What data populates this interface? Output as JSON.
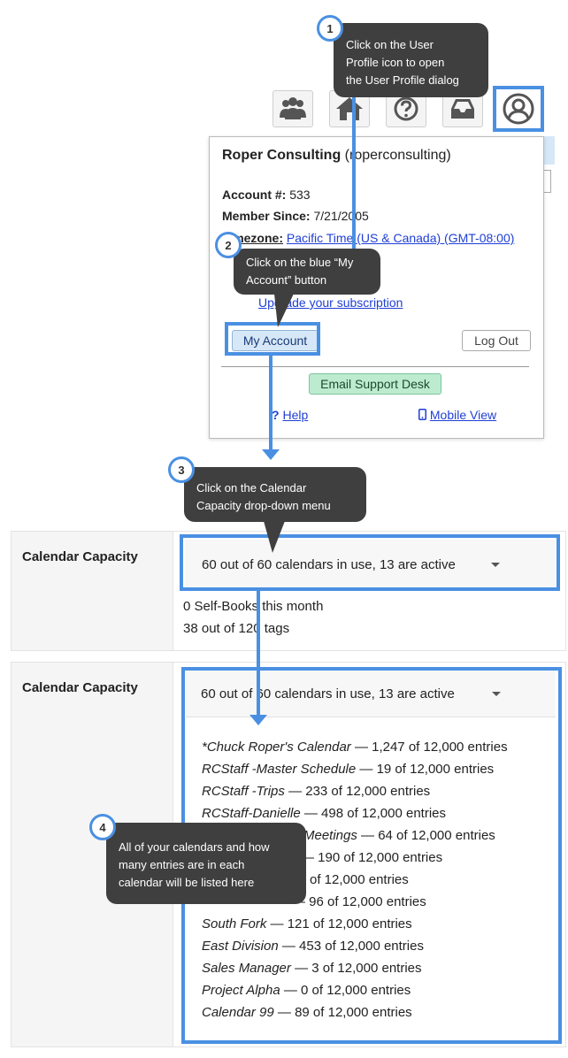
{
  "toolbar": {
    "icons": [
      "users-icon",
      "home-icon",
      "help-icon",
      "inbox-icon",
      "user-profile-icon"
    ]
  },
  "callouts": {
    "c1": {
      "number": "1",
      "line1": "Click on the User",
      "line2": "Profile icon to open",
      "line3": "the User Profile dialog"
    },
    "c2": {
      "number": "2",
      "line1": "Click on the blue “My",
      "line2": "Account” button"
    },
    "c3": {
      "number": "3",
      "line1": "Click on the Calendar",
      "line2": "Capacity drop-down menu"
    },
    "c4": {
      "number": "4",
      "line1": "All of your calendars and how",
      "line2": "many entries are in each",
      "line3": "calendar will be listed here"
    }
  },
  "profile": {
    "company": "Roper Consulting",
    "username_partial": "(roperconsulting)",
    "account_label": "Account #:",
    "account_value": "533",
    "member_label": "Member Since:",
    "member_value": "7/21/2005",
    "timezone_label": "Timezone:",
    "timezone_value": "Pacific Time (US & Canada) (GMT-08:00)",
    "upgrade_link": "Upgrade your subscription",
    "my_account_button": "My Account",
    "logout_button": "Log Out",
    "email_support_button": "Email Support Desk",
    "help_link": "Help",
    "mobile_link": "Mobile View"
  },
  "capacity": {
    "label": "Calendar Capacity",
    "dropdown_value": "60 out of 60 calendars in use, 13 are active",
    "self_books": "0 Self-Books this month",
    "tags": "38 out of 120 tags"
  },
  "capacity_expanded": {
    "label": "Calendar Capacity",
    "dropdown_value": "60 out of 60 calendars in use, 13 are active",
    "entries": [
      {
        "name": "*Chuck Roper's Calendar",
        "count": " — 1,247 of 12,000 entries"
      },
      {
        "name": "RCStaff -Master Schedule",
        "count": " — 19 of 12,000 entries"
      },
      {
        "name": "RCStaff -Trips",
        "count": " — 233 of 12,000 entries"
      },
      {
        "name": "RCStaff-Danielle",
        "count": " — 498 of 12,000 entries"
      },
      {
        "name": "Meetings",
        "count": " — 64 of 12,000 entries"
      },
      {
        "name": "",
        "count": " — 190 of 12,000 entries"
      },
      {
        "name": "",
        "count": " of 12,000 entries"
      },
      {
        "name": "",
        "count": " — 96 of 12,000 entries"
      },
      {
        "name": "South Fork",
        "count": " — 121 of 12,000 entries"
      },
      {
        "name": "East Division",
        "count": " — 453 of 12,000 entries"
      },
      {
        "name": "Sales Manager",
        "count": " — 3 of 12,000 entries"
      },
      {
        "name": "Project Alpha",
        "count": " — 0 of 12,000 entries"
      },
      {
        "name": "Calendar 99",
        "count": " — 89 of 12,000 entries"
      }
    ]
  },
  "colors": {
    "highlight": "#4a90e2",
    "callout": "#3f3f3f",
    "link": "#1f3fd6",
    "my_account_bg": "#d6e8f7",
    "email_bg": "#bdebd0"
  }
}
